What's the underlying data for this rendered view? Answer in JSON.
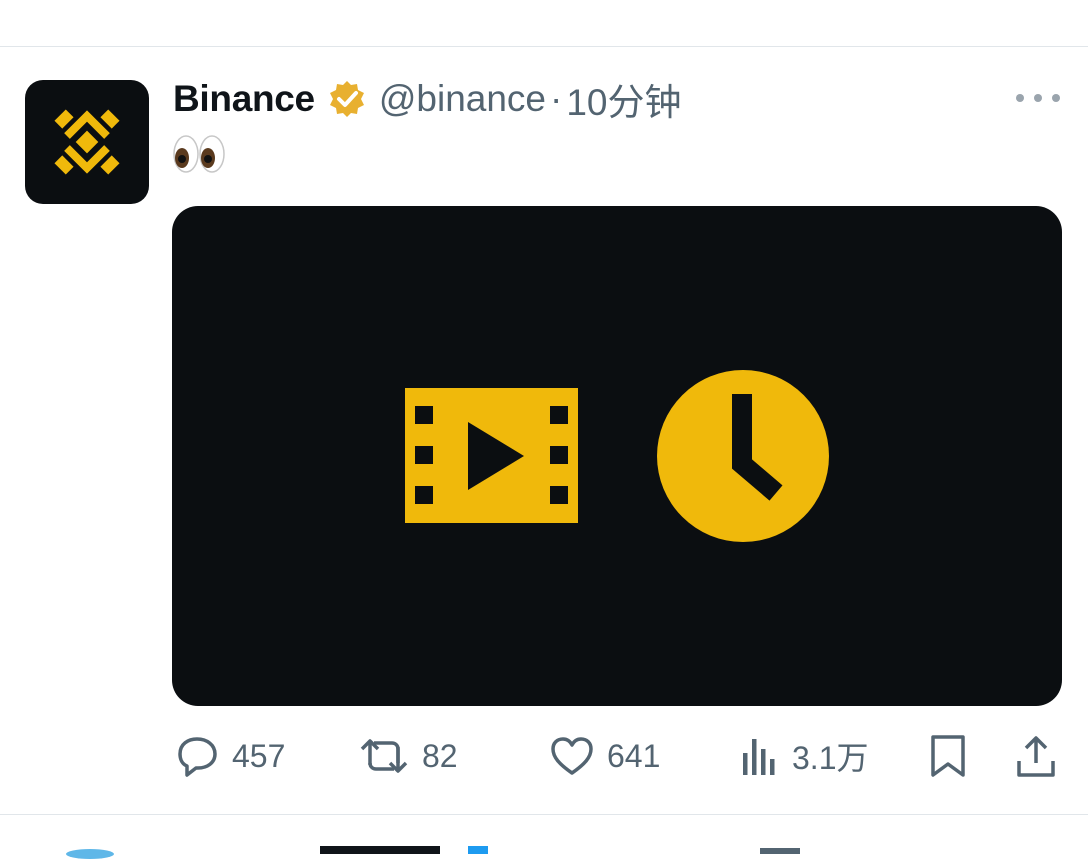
{
  "tweet": {
    "display_name": "Binance",
    "handle": "@binance",
    "separator": "·",
    "time": "10分钟",
    "text_emoji": "👀",
    "verified_color": "#E8B030",
    "brand_color": "#F0B90B",
    "media_bg": "#0B0E11",
    "media_icons": [
      "video-icon",
      "clock-icon"
    ]
  },
  "actions": {
    "replies": "457",
    "retweets": "82",
    "likes": "641",
    "views": "3.1万"
  },
  "colors": {
    "text_secondary": "#536471",
    "divider": "#E1E6EA"
  }
}
